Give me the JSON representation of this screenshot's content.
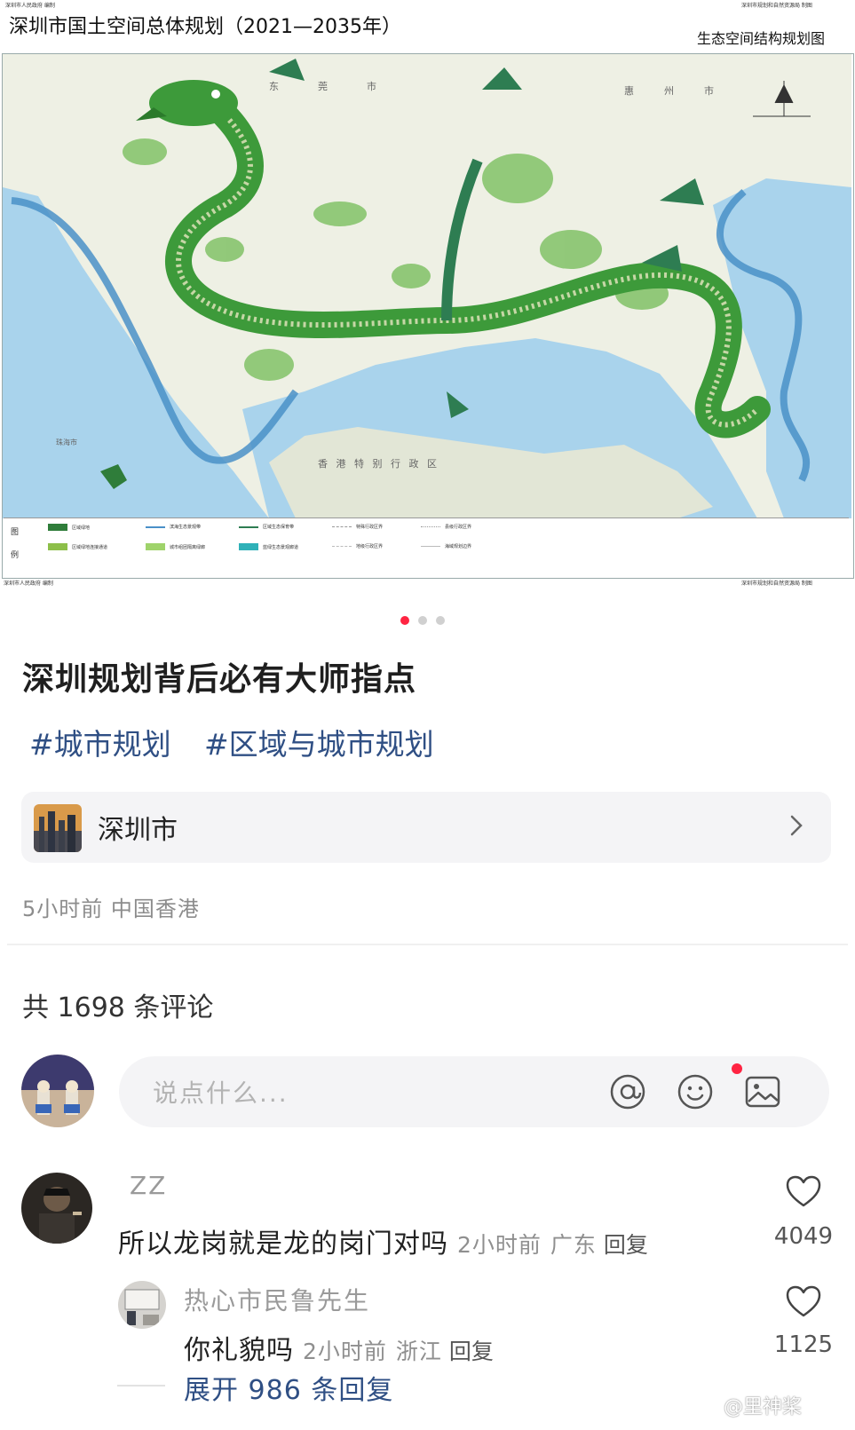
{
  "map": {
    "top_left_source": "深圳市人民政府 编制",
    "top_right_source": "深圳市规划和自然资源局 制图",
    "title": "深圳市国土空间总体规划（2021—2035年）",
    "subtitle": "生态空间结构规划图",
    "place_names": [
      "东",
      "莞",
      "市",
      "惠",
      "州",
      "市",
      "香 港 特 别 行 政 区",
      "珠海市"
    ],
    "legend_heading_1": "图",
    "legend_heading_2": "例",
    "legend_items": [
      "区域绿地",
      "滨海生态景观带",
      "区域生态保育带",
      "特殊行政区界",
      "县级行政区界",
      "区域绿地连接通道",
      "城市组团隔离绿廊",
      "蓝绿生态景观廊道",
      "地级行政区界",
      "海域规划边界"
    ],
    "bottom_left_source": "深圳市人民政府 编制",
    "bottom_right_source": "深圳市规划和自然资源局 制图",
    "colors": {
      "dragon": "#3d9a3a",
      "sea": "#a9d3ec",
      "river": "#4a90c8",
      "arrow": "#2e7d52"
    }
  },
  "carousel": {
    "count": 3,
    "active_index": 0,
    "active_color": "#ff2442",
    "inactive_color": "#d0d0d0"
  },
  "post": {
    "title": "深圳规划背后必有大师指点",
    "tags": [
      "#城市规划",
      "#区域与城市规划"
    ],
    "location": {
      "name": "深圳市",
      "chevron": "chevron-right-icon"
    },
    "time": "5小时前",
    "region": "中国香港",
    "comments_count_label": "共 1698 条评论"
  },
  "comment_input": {
    "placeholder": "说点什么...",
    "icons": [
      "at-icon",
      "emoji-icon",
      "image-icon"
    ]
  },
  "comments": [
    {
      "author": "ZZ",
      "text": "所以龙岗就是龙的岗门对吗",
      "time": "2小时前",
      "region": "广东",
      "reply_label": "回复",
      "likes": "4049"
    }
  ],
  "replies": [
    {
      "author": "热心市民鲁先生",
      "text": "你礼貌吗",
      "time": "2小时前",
      "region": "浙江",
      "reply_label": "回复",
      "likes": "1125"
    }
  ],
  "expand_replies_label": "展开 986 条回复",
  "watermark": "@里神桨"
}
